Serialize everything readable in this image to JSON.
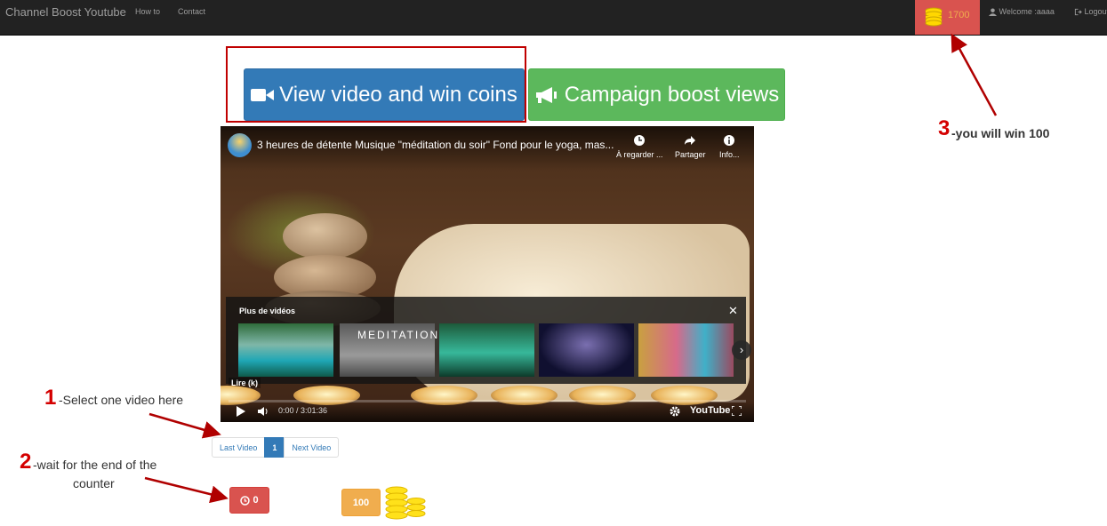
{
  "navbar": {
    "brand": "Channel Boost Youtube",
    "links": [
      "How to",
      "Contact"
    ],
    "coins_count": "1700",
    "welcome": "Welcome :aaaa",
    "logout": "Logout"
  },
  "actions": {
    "view_video_label": "View video and win coins",
    "campaign_label": "Campaign boost views"
  },
  "player": {
    "title": "3 heures de détente Musique \"méditation du soir\" Fond pour le yoga, mas...",
    "watch_later": "À regarder ...",
    "share": "Partager",
    "info": "Info...",
    "more_videos": "Plus de vidéos",
    "thumb_meditation_label": "MEDITATION",
    "play_hint": "Lire (k)",
    "time": "0:00 / 3:01:36",
    "youtube_logo": "YouTube"
  },
  "pagination": {
    "prev": "Last Video",
    "current": "1",
    "next": "Next Video"
  },
  "timer": {
    "value": "0"
  },
  "reward": {
    "value": "100"
  },
  "annotations": {
    "step1_num": "1",
    "step1_text": "-Select one video here",
    "step2_num": "2",
    "step2_text_line1": "-wait for the end of the",
    "step2_text_line2": "counter",
    "step3_num": "3",
    "step3_text": "-you will win 100"
  },
  "colors": {
    "navbar_bg": "#222222",
    "coins_box": "#d9534f",
    "primary": "#337ab7",
    "success": "#5cb85c",
    "danger": "#d9534f",
    "warning": "#f0ad4e",
    "annotation_red": "#d40000"
  }
}
